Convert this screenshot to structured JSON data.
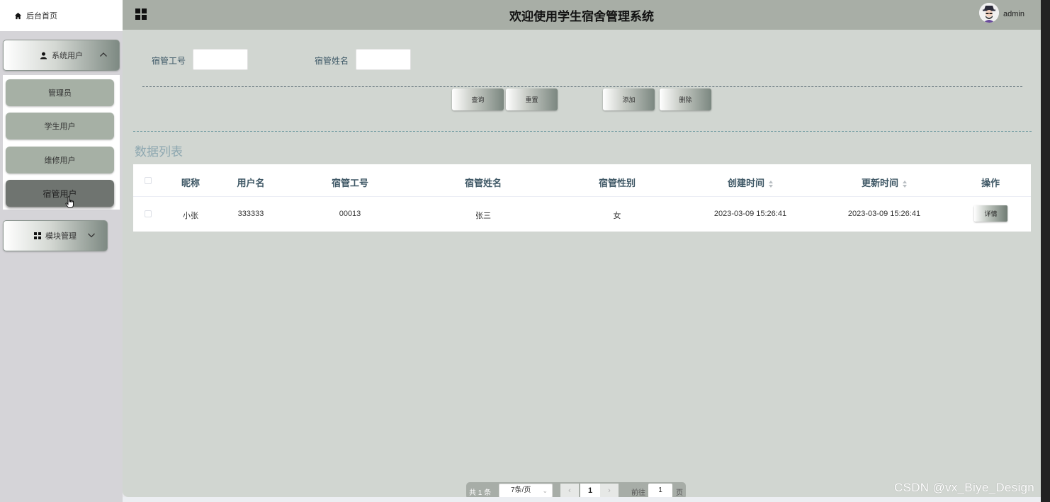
{
  "sidebar": {
    "home_label": "后台首页",
    "groups": [
      {
        "label": "系统用户",
        "expanded": true
      },
      {
        "label": "模块管理",
        "expanded": false
      }
    ],
    "sub_items": [
      {
        "label": "管理员",
        "active": false
      },
      {
        "label": "学生用户",
        "active": false
      },
      {
        "label": "维修用户",
        "active": false
      },
      {
        "label": "宿管用户",
        "active": true
      }
    ]
  },
  "header": {
    "title": "欢迎使用学生宿舍管理系统",
    "user": "admin"
  },
  "search": {
    "fields": [
      {
        "label": "宿管工号",
        "value": ""
      },
      {
        "label": "宿管姓名",
        "value": ""
      }
    ],
    "buttons": {
      "query": "查询",
      "reset": "重置",
      "add": "添加",
      "delete": "删除"
    }
  },
  "table": {
    "section_title": "数据列表",
    "columns": [
      "昵称",
      "用户名",
      "宿管工号",
      "宿管姓名",
      "宿管性别",
      "创建时间",
      "更新时间",
      "操作"
    ],
    "sortable_columns": [
      "创建时间",
      "更新时间"
    ],
    "rows": [
      {
        "nickname": "小张",
        "username": "333333",
        "staff_no": "00013",
        "name": "张三",
        "gender": "女",
        "created": "2023-03-09 15:26:41",
        "updated": "2023-03-09 15:26:41",
        "action": "详情"
      }
    ]
  },
  "pagination": {
    "total": "共 1 条",
    "page_size": "7条/页",
    "prev": "‹",
    "current_page": "1",
    "next": "›",
    "goto_label": "前往",
    "goto_value": "1",
    "page_suffix": "页"
  },
  "watermark": "CSDN @vx_Biye_Design",
  "colors": {
    "topbar": "#a8aea6",
    "main_bg": "#d1d6d1",
    "sidebar_bg": "#d5d4d8",
    "sub_item": "#a6b0a5",
    "sub_item_active": "#6f7470"
  }
}
